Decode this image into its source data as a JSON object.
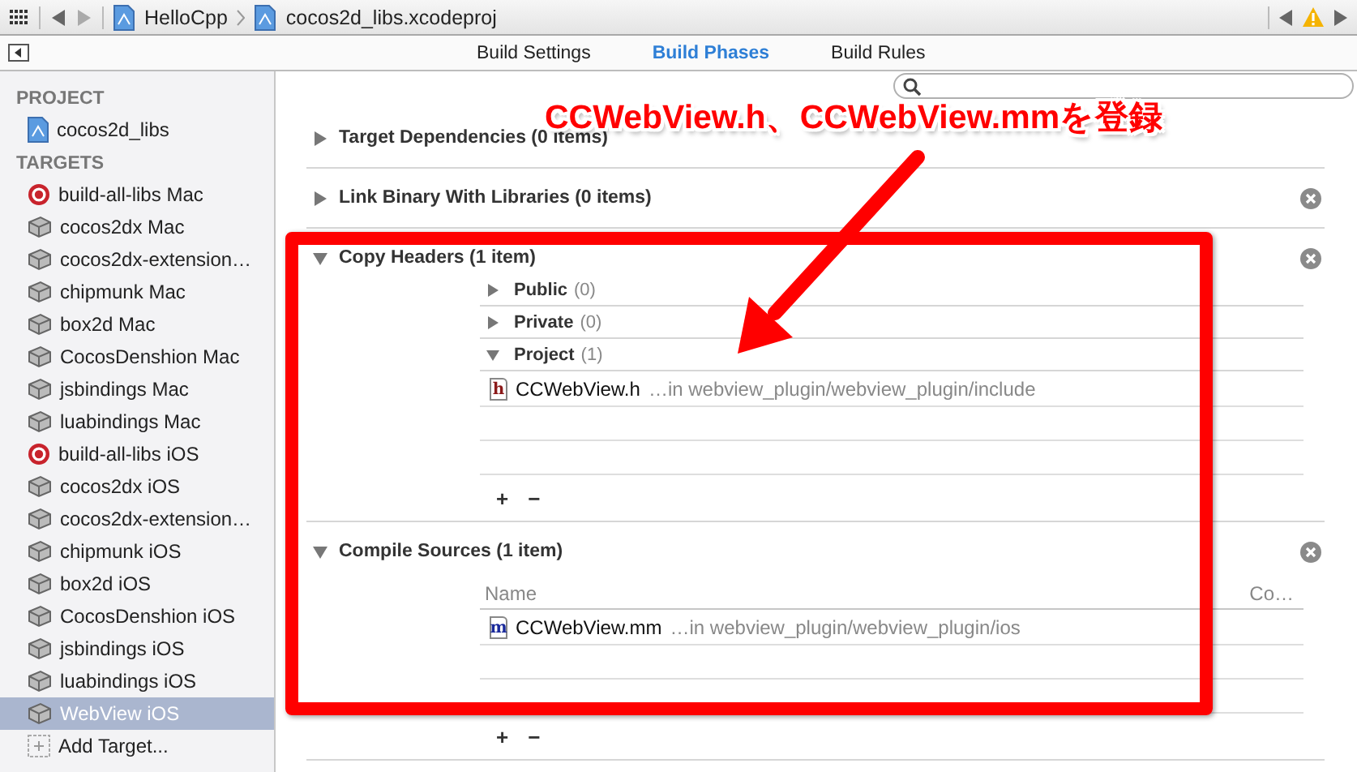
{
  "jump_bar": {
    "crumbs": [
      "HelloCpp",
      "cocos2d_libs.xcodeproj"
    ],
    "warning": true
  },
  "tabs": [
    {
      "label": "Build Settings",
      "selected": false
    },
    {
      "label": "Build Phases",
      "selected": true
    },
    {
      "label": "Build Rules",
      "selected": false
    }
  ],
  "sidebar": {
    "project_heading": "PROJECT",
    "project": "cocos2d_libs",
    "targets_heading": "TARGETS",
    "targets": [
      {
        "label": "build-all-libs Mac",
        "kind": "aggregate",
        "selected": false
      },
      {
        "label": "cocos2dx Mac",
        "kind": "library",
        "selected": false
      },
      {
        "label": "cocos2dx-extension…",
        "kind": "library",
        "selected": false
      },
      {
        "label": "chipmunk Mac",
        "kind": "library",
        "selected": false
      },
      {
        "label": "box2d Mac",
        "kind": "library",
        "selected": false
      },
      {
        "label": "CocosDenshion Mac",
        "kind": "library",
        "selected": false
      },
      {
        "label": "jsbindings Mac",
        "kind": "library",
        "selected": false
      },
      {
        "label": "luabindings Mac",
        "kind": "library",
        "selected": false
      },
      {
        "label": "build-all-libs iOS",
        "kind": "aggregate",
        "selected": false
      },
      {
        "label": "cocos2dx iOS",
        "kind": "library",
        "selected": false
      },
      {
        "label": "cocos2dx-extension…",
        "kind": "library",
        "selected": false
      },
      {
        "label": "chipmunk iOS",
        "kind": "library",
        "selected": false
      },
      {
        "label": "box2d iOS",
        "kind": "library",
        "selected": false
      },
      {
        "label": "CocosDenshion iOS",
        "kind": "library",
        "selected": false
      },
      {
        "label": "jsbindings iOS",
        "kind": "library",
        "selected": false
      },
      {
        "label": "luabindings iOS",
        "kind": "library",
        "selected": false
      },
      {
        "label": "WebView iOS",
        "kind": "library",
        "selected": true
      }
    ],
    "add_target": "Add Target..."
  },
  "phases": [
    {
      "title": "Target Dependencies (0 items)",
      "expanded": false,
      "removable": false
    },
    {
      "title": "Link Binary With Libraries (0 items)",
      "expanded": false,
      "removable": true
    },
    {
      "kind": "headers",
      "title": "Copy Headers (1 item)",
      "expanded": true,
      "removable": true,
      "groups": [
        {
          "label": "Public",
          "count": "(0)",
          "expanded": false
        },
        {
          "label": "Private",
          "count": "(0)",
          "expanded": false
        },
        {
          "label": "Project",
          "count": "(1)",
          "expanded": true
        }
      ],
      "files": [
        {
          "badge": "h",
          "name": "CCWebView.h",
          "path": "…in webview_plugin/webview_plugin/include"
        }
      ],
      "add": "+",
      "remove": "−"
    },
    {
      "kind": "sources",
      "title": "Compile Sources (1 item)",
      "expanded": true,
      "removable": true,
      "columns": [
        "Name",
        "Co…"
      ],
      "files": [
        {
          "badge": "m",
          "name": "CCWebView.mm",
          "path": "…in webview_plugin/webview_plugin/ios"
        }
      ],
      "add": "+",
      "remove": "−"
    }
  ],
  "annotation": {
    "text": "CCWebView.h、CCWebView.mmを登録"
  }
}
